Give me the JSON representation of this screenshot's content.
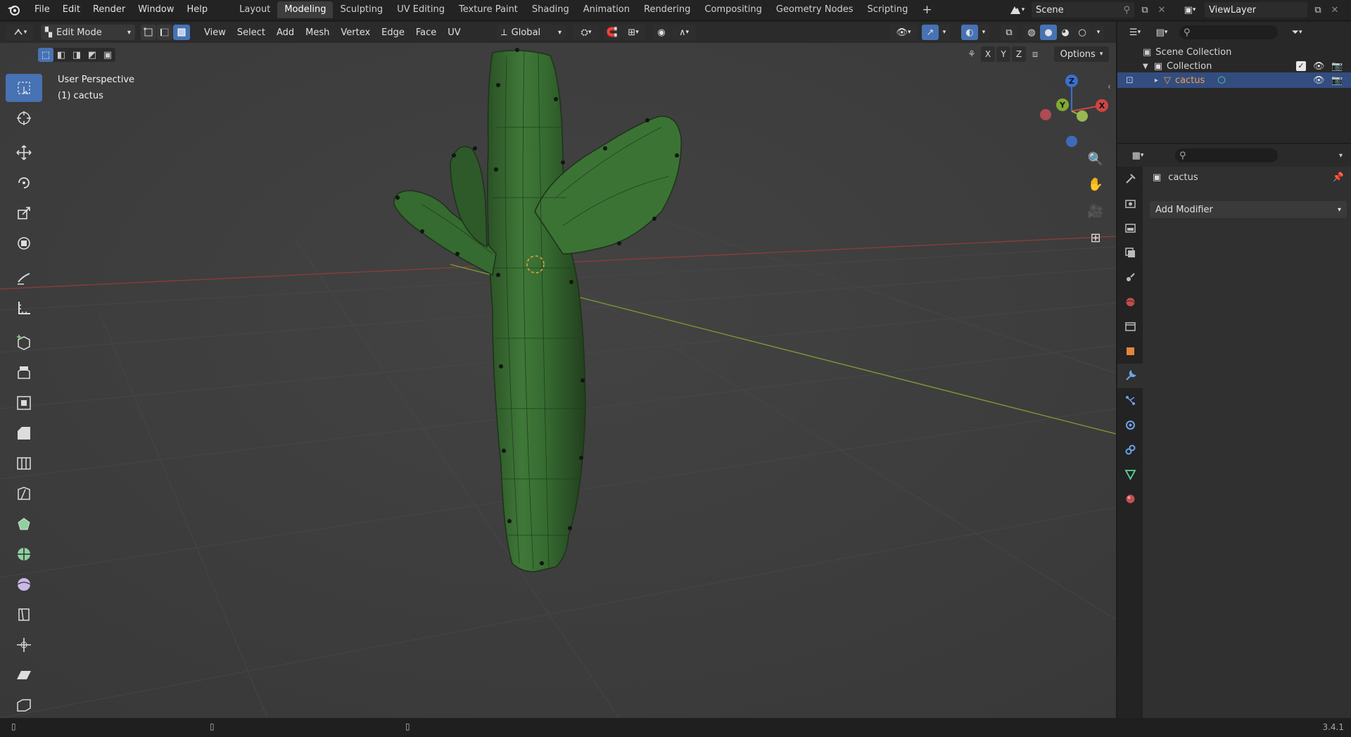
{
  "menu": [
    "File",
    "Edit",
    "Render",
    "Window",
    "Help"
  ],
  "workspaces": [
    {
      "label": "Layout",
      "active": false
    },
    {
      "label": "Modeling",
      "active": true
    },
    {
      "label": "Sculpting",
      "active": false
    },
    {
      "label": "UV Editing",
      "active": false
    },
    {
      "label": "Texture Paint",
      "active": false
    },
    {
      "label": "Shading",
      "active": false
    },
    {
      "label": "Animation",
      "active": false
    },
    {
      "label": "Rendering",
      "active": false
    },
    {
      "label": "Compositing",
      "active": false
    },
    {
      "label": "Geometry Nodes",
      "active": false
    },
    {
      "label": "Scripting",
      "active": false
    }
  ],
  "add_workspace": "+",
  "scene": {
    "name": "Scene"
  },
  "view_layer": {
    "name": "ViewLayer"
  },
  "header": {
    "mode": "Edit Mode",
    "menus": [
      "View",
      "Select",
      "Add",
      "Mesh",
      "Vertex",
      "Edge",
      "Face",
      "UV"
    ],
    "orientation": "Global",
    "axes": [
      "X",
      "Y",
      "Z"
    ],
    "options": "Options"
  },
  "viewport": {
    "perspective": "User Perspective",
    "object_label": "(1) cactus"
  },
  "gizmo": {
    "z": "Z",
    "y": "Y",
    "x": "X"
  },
  "outliner": {
    "root": "Scene Collection",
    "collection": "Collection",
    "object": "cactus"
  },
  "properties": {
    "object_name": "cactus",
    "add_modifier": "Add Modifier"
  },
  "status": {
    "version": "3.4.1"
  },
  "colors": {
    "accent": "#4772b3",
    "mesh": "#3a6e34",
    "x_axis": "#b64747",
    "y_axis": "#8aab3c"
  }
}
